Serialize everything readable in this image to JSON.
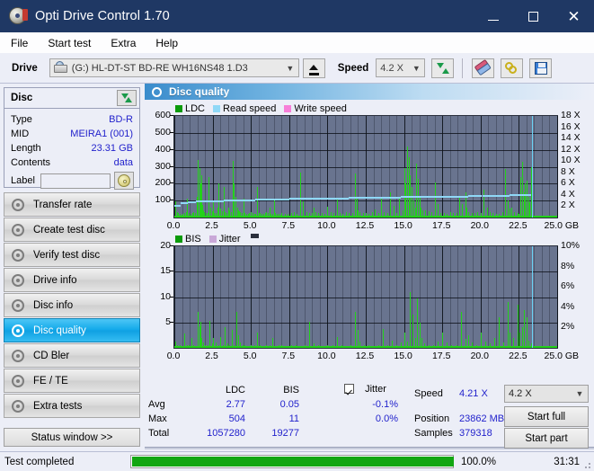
{
  "window": {
    "title": "Opti Drive Control 1.70",
    "icon": "disc-icon",
    "minimize": "minimize-icon",
    "maximize": "maximize-icon",
    "close": "close-icon"
  },
  "menu": {
    "items": [
      "File",
      "Start test",
      "Extra",
      "Help"
    ]
  },
  "toolbar": {
    "drive_label": "Drive",
    "drive_value": "(G:)  HL-DT-ST BD-RE  WH16NS48 1.D3",
    "eject_icon": "eject-icon",
    "speed_label": "Speed",
    "speed_value": "4.2 X",
    "refresh_icon": "refresh-icon",
    "erase_icon": "eraser-icon",
    "keys_icon": "keys-icon",
    "save_icon": "save-icon"
  },
  "disc_panel": {
    "title": "Disc",
    "refresh_icon": "refresh-icon",
    "rows": [
      {
        "key": "Type",
        "value": "BD-R"
      },
      {
        "key": "MID",
        "value": "MEIRA1 (001)"
      },
      {
        "key": "Length",
        "value": "23.31 GB"
      },
      {
        "key": "Contents",
        "value": "data"
      }
    ],
    "label_key": "Label",
    "label_value": "",
    "label_placeholder": "",
    "disc_icon": "cd-icon"
  },
  "nav": {
    "items": [
      {
        "label": "Transfer rate",
        "icon": "disc-icon",
        "active": false
      },
      {
        "label": "Create test disc",
        "icon": "disc-icon",
        "active": false
      },
      {
        "label": "Verify test disc",
        "icon": "disc-icon",
        "active": false
      },
      {
        "label": "Drive info",
        "icon": "disc-icon",
        "active": false
      },
      {
        "label": "Disc info",
        "icon": "disc-icon",
        "active": false
      },
      {
        "label": "Disc quality",
        "icon": "disc-icon",
        "active": true
      },
      {
        "label": "CD Bler",
        "icon": "disc-icon",
        "active": false
      },
      {
        "label": "FE / TE",
        "icon": "disc-icon",
        "active": false
      },
      {
        "label": "Extra tests",
        "icon": "disc-icon",
        "active": false
      }
    ],
    "status_window": "Status window >>"
  },
  "content": {
    "header_title": "Disc quality",
    "header_icon": "disc-icon"
  },
  "stats": {
    "col_headers": [
      "LDC",
      "BIS"
    ],
    "jitter_label": "Jitter",
    "jitter_checked": true,
    "rows": [
      {
        "name": "Avg",
        "ldc": "2.77",
        "bis": "0.05",
        "jitter": "-0.1%"
      },
      {
        "name": "Max",
        "ldc": "504",
        "bis": "11",
        "jitter": "0.0%"
      },
      {
        "name": "Total",
        "ldc": "1057280",
        "bis": "19277",
        "jitter": ""
      }
    ],
    "speed_label": "Speed",
    "speed_value": "4.21 X",
    "position_label": "Position",
    "position_value": "23862 MB",
    "samples_label": "Samples",
    "samples_value": "379318",
    "speed_select": "4.2 X",
    "start_full": "Start full",
    "start_part": "Start part"
  },
  "statusbar": {
    "text": "Test completed",
    "percent": "100.0%",
    "progress": 100,
    "elapsed": "31:31"
  },
  "colors": {
    "accent": "#12a9ea",
    "titlebar": "#1f3864",
    "plot_bg": "#69748f",
    "ldc_green": "#23d11a",
    "read_speed": "#8fd8f7",
    "write_speed": "#f77fd8",
    "jitter": "#c9a8d8",
    "value_blue": "#2222cc",
    "progress_green": "#12a612"
  },
  "chart_data": [
    {
      "type": "bar",
      "title": "LDC error rate vs disc position",
      "xlabel": "GB",
      "ylabel": "LDC",
      "y2label": "X",
      "legend": [
        {
          "label": "LDC",
          "color": "#23d11a"
        },
        {
          "label": "Read speed",
          "color": "#8fd8f7"
        },
        {
          "label": "Write speed",
          "color": "#f77fd8"
        }
      ],
      "legend_position": "top-left",
      "grid": true,
      "xlim": [
        0,
        25
      ],
      "ylim": [
        0,
        600
      ],
      "y2lim": [
        0,
        18
      ],
      "xticks": [
        "0.0",
        "2.5",
        "5.0",
        "7.5",
        "10.0",
        "12.5",
        "15.0",
        "17.5",
        "20.0",
        "22.5",
        "25.0"
      ],
      "yticks": [
        100,
        200,
        300,
        400,
        500,
        600
      ],
      "y2ticks": [
        "2 X",
        "4 X",
        "6 X",
        "8 X",
        "10 X",
        "12 X",
        "14 X",
        "16 X",
        "18 X"
      ],
      "x_unit_suffix": "GB",
      "series": [
        {
          "name": "LDC",
          "type": "bar",
          "color": "#23d11a",
          "x": [
            0.05,
            0.15,
            0.25,
            0.35,
            0.45,
            0.55,
            0.65,
            0.75,
            0.85,
            0.95,
            1.05,
            1.15,
            1.25,
            1.35,
            1.45,
            1.55,
            1.62,
            1.68,
            1.74,
            1.8,
            1.86,
            1.95,
            2.05,
            2.15,
            2.25,
            2.35,
            2.45,
            2.52,
            2.6,
            2.7,
            2.8,
            2.9,
            3.0,
            3.1,
            3.2,
            3.3,
            3.4,
            3.5,
            3.6,
            3.7,
            3.8,
            3.9,
            4.0,
            4.1,
            4.15,
            4.22,
            4.3,
            4.4,
            4.5,
            4.6,
            4.7,
            4.8,
            4.9,
            5.0,
            5.1,
            5.2,
            5.3,
            5.4,
            5.5,
            5.6,
            5.7,
            5.8,
            5.9,
            6.0,
            6.1,
            6.2,
            6.3,
            6.4,
            6.5,
            6.6,
            6.7,
            6.8,
            6.9,
            7.0,
            7.2,
            7.4,
            7.6,
            7.8,
            8.0,
            8.2,
            8.4,
            8.6,
            8.8,
            9.0,
            9.1,
            9.2,
            9.4,
            9.6,
            9.8,
            10.0,
            10.2,
            10.4,
            10.6,
            10.8,
            11.0,
            11.2,
            11.4,
            11.6,
            11.8,
            11.9,
            12.0,
            12.1,
            12.3,
            12.5,
            12.7,
            12.9,
            13.1,
            13.3,
            13.5,
            13.7,
            13.9,
            14.1,
            14.3,
            14.5,
            14.7,
            14.9,
            15.0,
            15.1,
            15.2,
            15.3,
            15.4,
            15.5,
            15.6,
            15.7,
            15.8,
            15.9,
            16.0,
            16.1,
            16.2,
            16.4,
            16.6,
            16.8,
            17.0,
            17.2,
            17.4,
            17.6,
            17.8,
            18.0,
            18.2,
            18.4,
            18.6,
            18.8,
            19.0,
            19.1,
            19.2,
            19.4,
            19.6,
            19.8,
            20.0,
            20.2,
            20.4,
            20.6,
            20.8,
            21.0,
            21.2,
            21.4,
            21.6,
            21.8,
            21.9,
            22.0,
            22.2,
            22.4,
            22.5,
            22.6,
            22.7,
            22.8,
            22.9,
            23.0,
            23.1,
            23.2,
            23.3
          ],
          "y": [
            95,
            30,
            25,
            20,
            18,
            22,
            25,
            30,
            110,
            28,
            22,
            25,
            30,
            28,
            120,
            340,
            290,
            200,
            250,
            75,
            45,
            30,
            28,
            25,
            240,
            60,
            35,
            100,
            28,
            25,
            60,
            200,
            55,
            35,
            180,
            32,
            28,
            60,
            45,
            30,
            335,
            200,
            120,
            60,
            40,
            35,
            30,
            28,
            110,
            25,
            22,
            20,
            25,
            30,
            25,
            22,
            20,
            180,
            28,
            25,
            22,
            20,
            25,
            30,
            28,
            60,
            22,
            20,
            110,
            25,
            22,
            20,
            18,
            25,
            22,
            20,
            25,
            30,
            22,
            265,
            95,
            30,
            28,
            25,
            60,
            30,
            28,
            25,
            22,
            65,
            30,
            28,
            110,
            25,
            22,
            30,
            28,
            25,
            260,
            120,
            45,
            30,
            28,
            25,
            22,
            30,
            50,
            25,
            120,
            30,
            28,
            150,
            70,
            25,
            120,
            40,
            290,
            200,
            420,
            355,
            250,
            180,
            100,
            60,
            320,
            230,
            130,
            60,
            45,
            40,
            35,
            30,
            205,
            80,
            28,
            25,
            22,
            30,
            28,
            25,
            120,
            80,
            150,
            60,
            30,
            28,
            25,
            30,
            28,
            165,
            60,
            30,
            25,
            22,
            20,
            30,
            285,
            100,
            55,
            60,
            30,
            25,
            20,
            240,
            330,
            150,
            200,
            220,
            120,
            90,
            300,
            40
          ]
        },
        {
          "name": "Read speed",
          "type": "line",
          "color": "#8fd8f7",
          "axis": "y2",
          "x": [
            0.0,
            0.4,
            0.9,
            1.4,
            2.0,
            2.6,
            3.2,
            3.9,
            4.6,
            5.3,
            6.0,
            6.8,
            7.5,
            8.2,
            9.0,
            9.8,
            10.6,
            11.4,
            12.2,
            13.0,
            13.9,
            14.8,
            15.6,
            16.5,
            17.4,
            18.3,
            19.2,
            20.1,
            21.0,
            21.9,
            22.8,
            23.3
          ],
          "y": [
            1.9,
            2.6,
            2.8,
            2.9,
            3.0,
            3.05,
            3.1,
            3.15,
            3.2,
            3.25,
            3.3,
            3.35,
            3.4,
            3.45,
            3.5,
            3.5,
            3.55,
            3.6,
            3.6,
            3.65,
            3.7,
            3.75,
            3.8,
            3.8,
            3.85,
            3.9,
            3.9,
            3.95,
            4.0,
            4.05,
            4.1,
            4.15
          ]
        },
        {
          "name": "Write speed",
          "type": "line",
          "color": "#f77fd8",
          "axis": "y2",
          "x": [],
          "y": []
        }
      ],
      "cursor_x": 23.35
    },
    {
      "type": "bar",
      "title": "BIS error rate and Jitter vs disc position",
      "xlabel": "GB",
      "ylabel": "BIS",
      "y2label": "%",
      "legend": [
        {
          "label": "BIS",
          "color": "#23d11a"
        },
        {
          "label": "Jitter",
          "color": "#c9a8d8"
        }
      ],
      "legend_position": "top-left",
      "grid": true,
      "xlim": [
        0,
        25
      ],
      "ylim": [
        0,
        20
      ],
      "y2lim": [
        0,
        10
      ],
      "xticks": [
        "0.0",
        "2.5",
        "5.0",
        "7.5",
        "10.0",
        "12.5",
        "15.0",
        "17.5",
        "20.0",
        "22.5",
        "25.0"
      ],
      "yticks": [
        5,
        10,
        15,
        20
      ],
      "y2ticks": [
        "2%",
        "4%",
        "6%",
        "8%",
        "10%"
      ],
      "x_unit_suffix": "GB",
      "series": [
        {
          "name": "BIS",
          "type": "bar",
          "color": "#23d11a",
          "x": [
            0.05,
            0.2,
            0.35,
            0.5,
            0.65,
            0.8,
            0.95,
            1.1,
            1.25,
            1.4,
            1.55,
            1.62,
            1.7,
            1.78,
            1.86,
            2.0,
            2.15,
            2.3,
            2.45,
            2.55,
            2.7,
            2.85,
            3.0,
            3.15,
            3.3,
            3.45,
            3.6,
            3.75,
            3.9,
            4.05,
            4.15,
            4.3,
            4.45,
            4.6,
            4.8,
            5.0,
            5.2,
            5.4,
            5.6,
            5.8,
            6.0,
            6.2,
            6.4,
            6.6,
            6.8,
            7.0,
            7.3,
            7.6,
            7.9,
            8.2,
            8.5,
            8.8,
            9.1,
            9.4,
            9.7,
            10.0,
            10.3,
            10.6,
            10.9,
            11.2,
            11.5,
            11.8,
            11.95,
            12.1,
            12.4,
            12.7,
            13.0,
            13.3,
            13.6,
            13.9,
            14.2,
            14.5,
            14.8,
            15.0,
            15.2,
            15.4,
            15.55,
            15.7,
            15.85,
            16.0,
            16.15,
            16.3,
            16.6,
            16.9,
            17.2,
            17.5,
            17.8,
            18.1,
            18.4,
            18.7,
            19.0,
            19.2,
            19.4,
            19.7,
            20.0,
            20.3,
            20.6,
            20.9,
            21.2,
            21.5,
            21.75,
            21.9,
            22.1,
            22.4,
            22.55,
            22.7,
            22.85,
            23.0,
            23.15,
            23.3
          ],
          "y": [
            1.2,
            0.6,
            0.5,
            0.4,
            2.8,
            0.6,
            0.5,
            2.0,
            0.5,
            0.4,
            7.0,
            4.2,
            5.2,
            2.0,
            1.0,
            0.6,
            0.5,
            5.3,
            0.8,
            2.0,
            1.0,
            0.6,
            2.2,
            0.5,
            4.0,
            0.8,
            0.5,
            3.5,
            0.6,
            7.0,
            2.5,
            1.0,
            0.6,
            0.5,
            0.4,
            0.6,
            0.5,
            3.0,
            0.5,
            0.4,
            0.6,
            0.5,
            2.0,
            0.4,
            0.6,
            0.5,
            0.4,
            0.6,
            0.5,
            0.4,
            0.6,
            5.2,
            0.8,
            0.5,
            0.4,
            0.6,
            0.5,
            2.1,
            0.5,
            0.4,
            0.6,
            7.0,
            3.5,
            1.2,
            0.6,
            0.5,
            0.4,
            0.6,
            3.8,
            0.5,
            1.5,
            0.6,
            1.0,
            3.0,
            1.2,
            11.0,
            6.5,
            2.0,
            9.8,
            5.0,
            2.0,
            0.8,
            0.6,
            0.5,
            1.2,
            3.0,
            1.0,
            0.6,
            0.5,
            7.0,
            1.8,
            2.5,
            1.0,
            0.6,
            3.0,
            1.2,
            0.8,
            2.0,
            6.0,
            1.0,
            9.0,
            3.0,
            2.0,
            8.5,
            3.0,
            4.0,
            7.5,
            6.0,
            1.5,
            0.8
          ]
        },
        {
          "name": "Jitter",
          "type": "line",
          "color": "#c9a8d8",
          "axis": "y2",
          "x": [],
          "y": []
        }
      ],
      "cursor_x": 23.35
    }
  ]
}
